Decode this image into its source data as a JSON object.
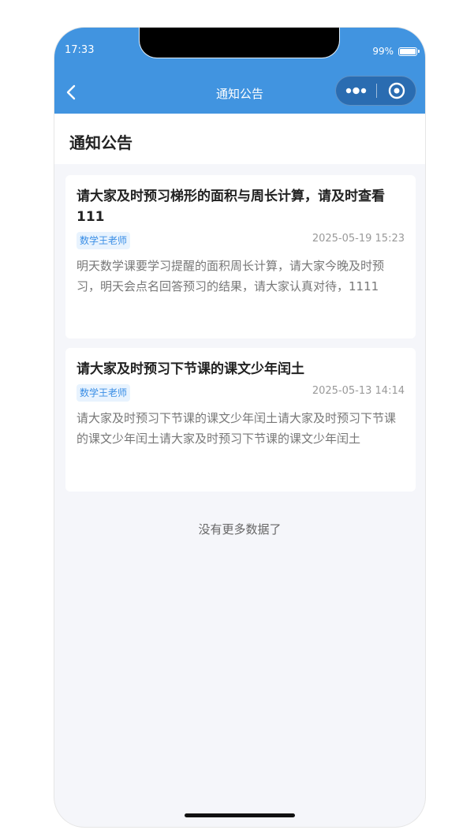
{
  "status_bar": {
    "time": "17:33",
    "battery_percent": "99%",
    "battery_level": 0.99
  },
  "nav": {
    "title": "通知公告",
    "back_icon": "chevron-left-icon",
    "menu_icon": "more-dots-icon",
    "close_icon": "target-circle-icon"
  },
  "page": {
    "title": "通知公告"
  },
  "notices": [
    {
      "title": "请大家及时预习梯形的面积与周长计算，请及时查看111",
      "author": "数学王老师",
      "date": "2025-05-19 15:23",
      "content": "明天数学课要学习提醒的面积周长计算，请大家今晚及时预习，明天会点名回答预习的结果，请大家认真对待，1111"
    },
    {
      "title": "请大家及时预习下节课的课文少年闰土",
      "author": "数学王老师",
      "date": "2025-05-13 14:14",
      "content": "请大家及时预习下节课的课文少年闰土请大家及时预习下节课的课文少年闰土请大家及时预习下节课的课文少年闰土"
    }
  ],
  "footer": {
    "no_more": "没有更多数据了"
  },
  "colors": {
    "nav_bg": "#4194e0",
    "capsule_bg": "#2a6cb1",
    "page_bg": "#f5f6fa",
    "tag_bg": "#e8f3fe",
    "tag_text": "#3a8ee6"
  }
}
